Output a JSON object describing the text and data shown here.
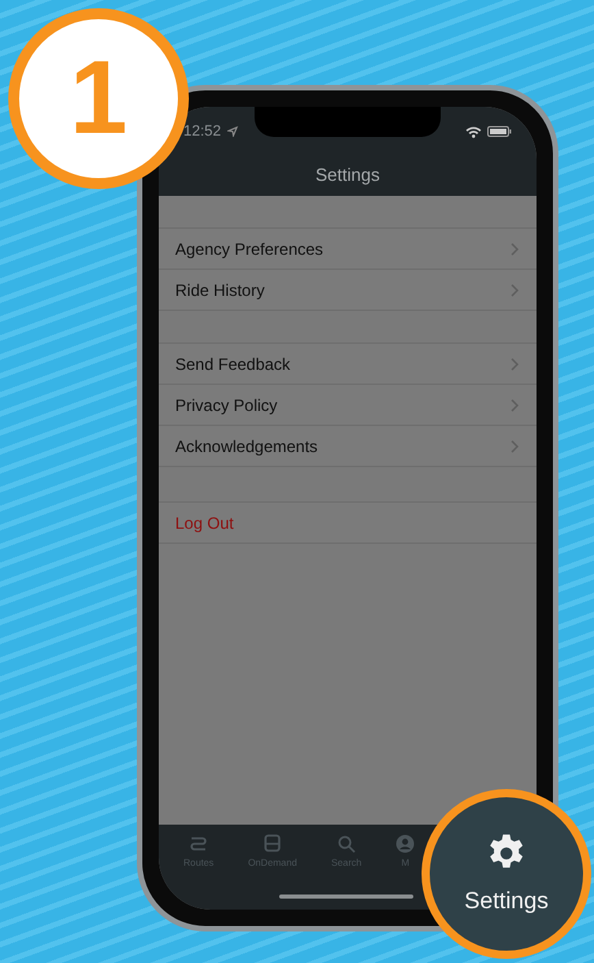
{
  "step_badge": {
    "number": "1"
  },
  "status_bar": {
    "time": "12:52"
  },
  "header": {
    "title": "Settings"
  },
  "sections": [
    {
      "items": [
        {
          "label": "Agency Preferences",
          "kind": "link"
        },
        {
          "label": "Ride History",
          "kind": "link"
        }
      ]
    },
    {
      "items": [
        {
          "label": "Send Feedback",
          "kind": "link"
        },
        {
          "label": "Privacy Policy",
          "kind": "link"
        },
        {
          "label": "Acknowledgements",
          "kind": "link"
        }
      ]
    },
    {
      "items": [
        {
          "label": "Log Out",
          "kind": "danger"
        }
      ]
    }
  ],
  "tab_bar": [
    {
      "label": "Routes"
    },
    {
      "label": "OnDemand"
    },
    {
      "label": "Search"
    },
    {
      "label": "M"
    }
  ],
  "callout": {
    "label": "Settings"
  }
}
